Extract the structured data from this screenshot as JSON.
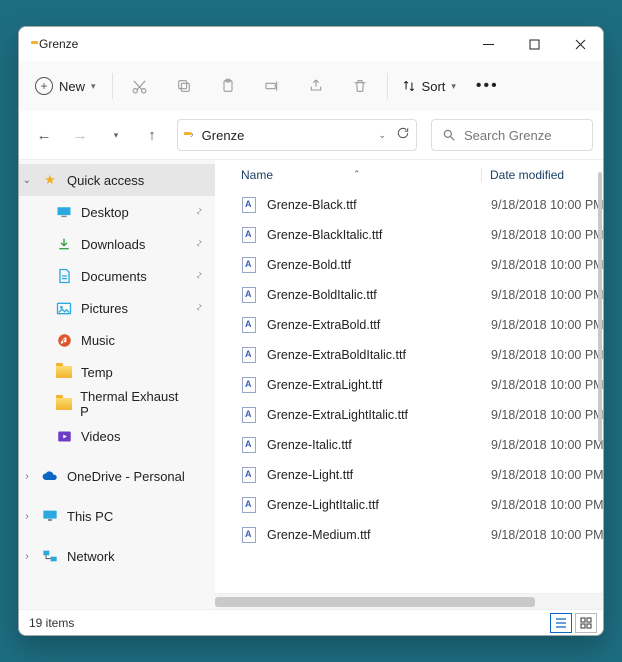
{
  "title": "Grenze",
  "toolbar": {
    "new_label": "New",
    "sort_label": "Sort"
  },
  "crumb": {
    "folder": "Grenze"
  },
  "search": {
    "placeholder": "Search Grenze"
  },
  "sidebar": {
    "quick_access": "Quick access",
    "pinned": [
      {
        "icon": "desktop",
        "label": "Desktop"
      },
      {
        "icon": "download",
        "label": "Downloads"
      },
      {
        "icon": "document",
        "label": "Documents"
      },
      {
        "icon": "pictures",
        "label": "Pictures"
      },
      {
        "icon": "music",
        "label": "Music"
      },
      {
        "icon": "folder",
        "label": "Temp"
      },
      {
        "icon": "folder",
        "label": "Thermal Exhaust P"
      },
      {
        "icon": "videos",
        "label": "Videos"
      }
    ],
    "onedrive": "OneDrive - Personal",
    "this_pc": "This PC",
    "network": "Network"
  },
  "columns": {
    "name": "Name",
    "date": "Date modified"
  },
  "files": [
    {
      "name": "Grenze-Black.ttf",
      "date": "9/18/2018 10:00 PM"
    },
    {
      "name": "Grenze-BlackItalic.ttf",
      "date": "9/18/2018 10:00 PM"
    },
    {
      "name": "Grenze-Bold.ttf",
      "date": "9/18/2018 10:00 PM"
    },
    {
      "name": "Grenze-BoldItalic.ttf",
      "date": "9/18/2018 10:00 PM"
    },
    {
      "name": "Grenze-ExtraBold.ttf",
      "date": "9/18/2018 10:00 PM"
    },
    {
      "name": "Grenze-ExtraBoldItalic.ttf",
      "date": "9/18/2018 10:00 PM"
    },
    {
      "name": "Grenze-ExtraLight.ttf",
      "date": "9/18/2018 10:00 PM"
    },
    {
      "name": "Grenze-ExtraLightItalic.ttf",
      "date": "9/18/2018 10:00 PM"
    },
    {
      "name": "Grenze-Italic.ttf",
      "date": "9/18/2018 10:00 PM"
    },
    {
      "name": "Grenze-Light.ttf",
      "date": "9/18/2018 10:00 PM"
    },
    {
      "name": "Grenze-LightItalic.ttf",
      "date": "9/18/2018 10:00 PM"
    },
    {
      "name": "Grenze-Medium.ttf",
      "date": "9/18/2018 10:00 PM"
    }
  ],
  "status": {
    "count": "19 items"
  },
  "icons": {
    "pinned_colors": {
      "desktop": "#2aa9e0",
      "download": "#3aa24a",
      "document": "#2aa9e0",
      "pictures": "#2aa9e0",
      "music": "#e0542a",
      "folder": "#f0b431",
      "videos": "#6d3cc7"
    }
  }
}
